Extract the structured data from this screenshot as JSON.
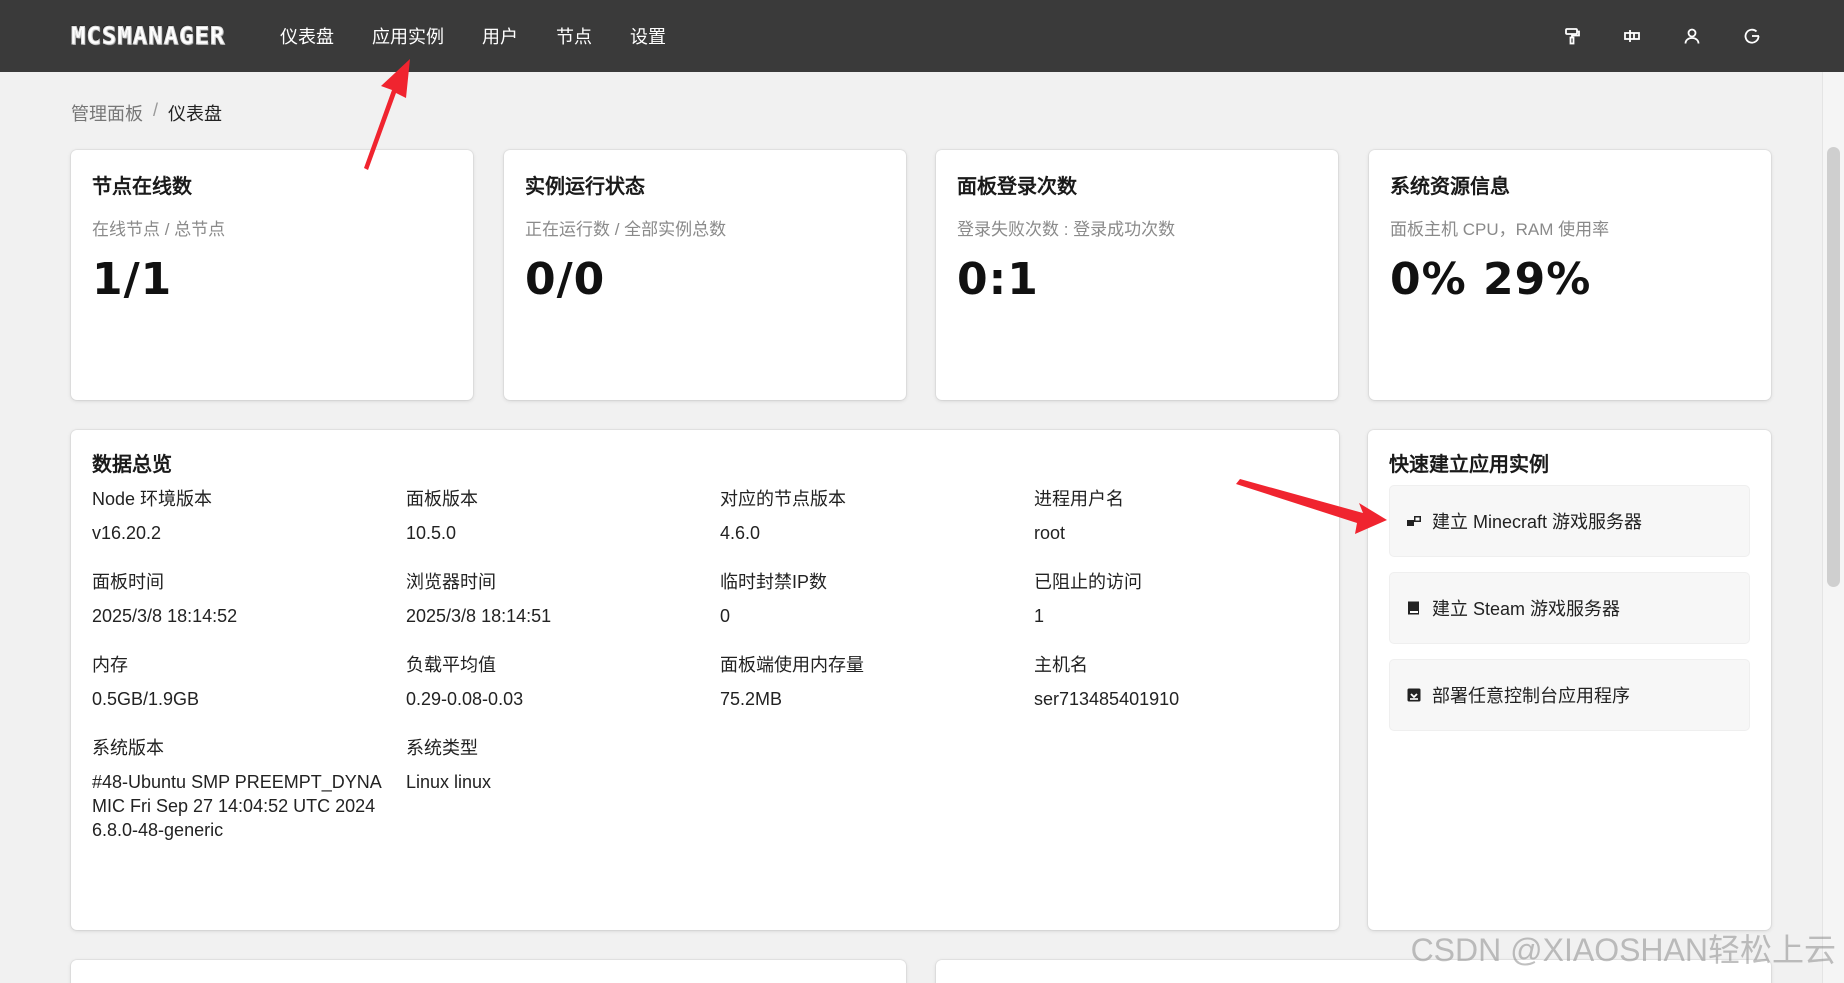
{
  "header": {
    "logo": "MCSMANAGER",
    "nav": [
      "仪表盘",
      "应用实例",
      "用户",
      "节点",
      "设置"
    ],
    "icons": [
      "paint-brush-icon",
      "layout-icon",
      "user-icon",
      "logout-icon"
    ]
  },
  "breadcrumb": {
    "parent": "管理面板",
    "separator": "/",
    "current": "仪表盘"
  },
  "stats": [
    {
      "title": "节点在线数",
      "subtitle": "在线节点 / 总节点",
      "value": "1/1"
    },
    {
      "title": "实例运行状态",
      "subtitle": "正在运行数 / 全部实例总数",
      "value": "0/0"
    },
    {
      "title": "面板登录次数",
      "subtitle": "登录失败次数 : 登录成功次数",
      "value": "0:1"
    },
    {
      "title": "系统资源信息",
      "subtitle": "面板主机 CPU，RAM 使用率",
      "value": "0% 29%"
    }
  ],
  "overview": {
    "title": "数据总览",
    "items": [
      {
        "label": "Node 环境版本",
        "value": "v16.20.2"
      },
      {
        "label": "面板版本",
        "value": "10.5.0"
      },
      {
        "label": "对应的节点版本",
        "value": "4.6.0"
      },
      {
        "label": "进程用户名",
        "value": "root"
      },
      {
        "label": "面板时间",
        "value": "2025/3/8 18:14:52"
      },
      {
        "label": "浏览器时间",
        "value": "2025/3/8 18:14:51"
      },
      {
        "label": "临时封禁IP数",
        "value": "0"
      },
      {
        "label": "已阻止的访问",
        "value": "1"
      },
      {
        "label": "内存",
        "value": "0.5GB/1.9GB"
      },
      {
        "label": "负载平均值",
        "value": "0.29-0.08-0.03"
      },
      {
        "label": "面板端使用内存量",
        "value": "75.2MB"
      },
      {
        "label": "主机名",
        "value": "ser713485401910"
      },
      {
        "label": "系统版本",
        "value": "#48-Ubuntu SMP PREEMPT_DYNAMIC Fri Sep 27 14:04:52 UTC 2024 6.8.0-48-generic"
      },
      {
        "label": "系统类型",
        "value": "Linux linux"
      }
    ]
  },
  "quick": {
    "title": "快速建立应用实例",
    "buttons": [
      {
        "label": "建立 Minecraft 游戏服务器",
        "icon": "block-icon"
      },
      {
        "label": "建立 Steam 游戏服务器",
        "icon": "book-icon"
      },
      {
        "label": "部署任意控制台应用程序",
        "icon": "download-box-icon"
      }
    ]
  },
  "watermark": "CSDN @XIAOSHAN轻松上云",
  "colors": {
    "header_bg": "#3a3a3a",
    "page_bg": "#f1f1f1",
    "arrow": "#f0242f"
  }
}
